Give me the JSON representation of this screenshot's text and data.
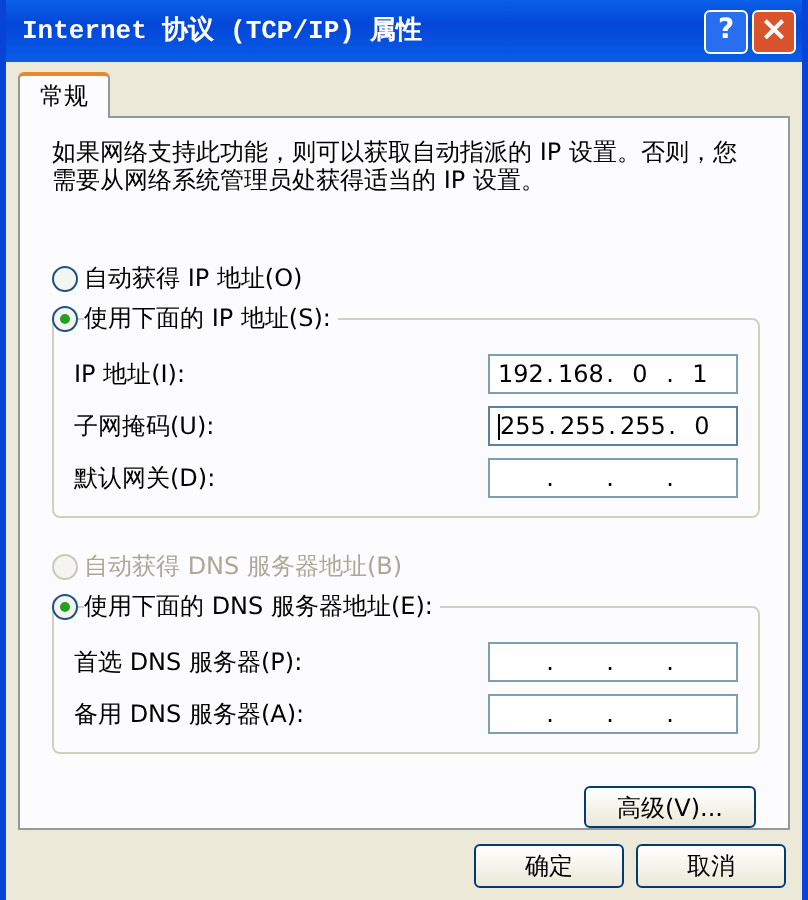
{
  "window": {
    "title": "Internet 协议 (TCP/IP) 属性",
    "help_button": "?",
    "close_button": "×"
  },
  "tabs": [
    {
      "label": "常规",
      "selected": true
    }
  ],
  "description": "如果网络支持此功能，则可以获取自动指派的 IP 设置。否则，您需要从网络系统管理员处获得适当的 IP 设置。",
  "ip_options": [
    {
      "label": "自动获得 IP 地址(O)",
      "selected": false,
      "disabled": false
    },
    {
      "label": "使用下面的 IP 地址(S):",
      "selected": true,
      "disabled": false
    }
  ],
  "ip_fields": [
    {
      "label": "IP 地址(I):",
      "octets": [
        "192",
        "168",
        "0",
        "1"
      ],
      "dots": [
        ".",
        ".",
        "."
      ],
      "focused": false
    },
    {
      "label": "子网掩码(U):",
      "octets": [
        "255",
        "255",
        "255",
        "0"
      ],
      "dots": [
        ".",
        ".",
        "."
      ],
      "focused": true
    },
    {
      "label": "默认网关(D):",
      "dots": [
        ".",
        ".",
        "."
      ],
      "focused": false
    }
  ],
  "dns_options": [
    {
      "label": "自动获得 DNS 服务器地址(B)",
      "selected": false,
      "disabled": true
    },
    {
      "label": "使用下面的 DNS 服务器地址(E):",
      "selected": true,
      "disabled": false
    }
  ],
  "dns_fields": [
    {
      "label": "首选 DNS 服务器(P):",
      "dots": [
        ".",
        ".",
        "."
      ],
      "focused": false
    },
    {
      "label": "备用 DNS 服务器(A):",
      "dots": [
        ".",
        ".",
        "."
      ],
      "focused": false
    }
  ],
  "advanced_button": "高级(V)...",
  "buttons": [
    "确定",
    "取消"
  ]
}
